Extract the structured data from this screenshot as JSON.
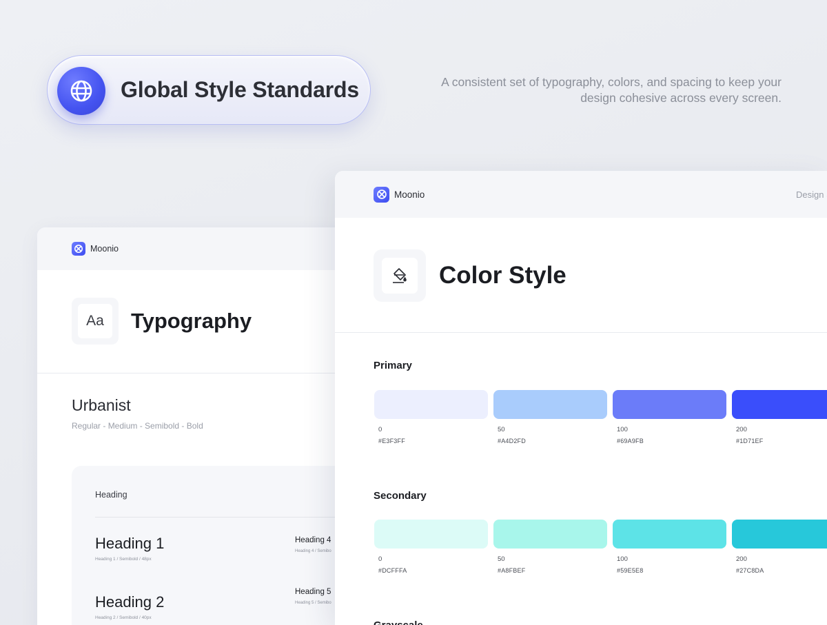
{
  "hero": {
    "title": "Global Style Standards",
    "icon": "globe-icon",
    "description": "A consistent set of typography, colors, and spacing to keep your design cohesive across every screen."
  },
  "typography_card": {
    "brand": "Moonio",
    "icon_text": "Aa",
    "title": "Typography",
    "font_name": "Urbanist",
    "font_weights": "Regular - Medium - Semibold - Bold",
    "panel_label": "Heading",
    "headings": [
      {
        "name": "Heading 1",
        "meta": "Heading 1 / Semibold / 48px"
      },
      {
        "name": "Heading 2",
        "meta": "Heading 2 / Semibold / 40px"
      },
      {
        "name": "Heading 4",
        "meta": "Heading 4 / Semibo"
      },
      {
        "name": "Heading 5",
        "meta": "Heading 5 / Semibo"
      }
    ]
  },
  "color_card": {
    "brand": "Moonio",
    "nav_right": "Design S",
    "icon": "paint-bucket-icon",
    "title": "Color Style",
    "groups": [
      {
        "label": "Primary",
        "swatches": [
          {
            "level": "0",
            "hex": "#E3F3FF",
            "color": "#ECEFFE"
          },
          {
            "level": "50",
            "hex": "#A4D2FD",
            "color": "#A9CCFC"
          },
          {
            "level": "100",
            "hex": "#69A9FB",
            "color": "#6B7CF9"
          },
          {
            "level": "200",
            "hex": "#1D71EF",
            "color": "#3A4EFB"
          }
        ]
      },
      {
        "label": "Secondary",
        "swatches": [
          {
            "level": "0",
            "hex": "#DCFFFA",
            "color": "#DCFBF7"
          },
          {
            "level": "50",
            "hex": "#A8FBEF",
            "color": "#A8F6EB"
          },
          {
            "level": "100",
            "hex": "#59E5E8",
            "color": "#5DE3E7"
          },
          {
            "level": "200",
            "hex": "#27C8DA",
            "color": "#27C8DA"
          }
        ]
      },
      {
        "label": "Grayscale",
        "swatches": []
      }
    ]
  }
}
